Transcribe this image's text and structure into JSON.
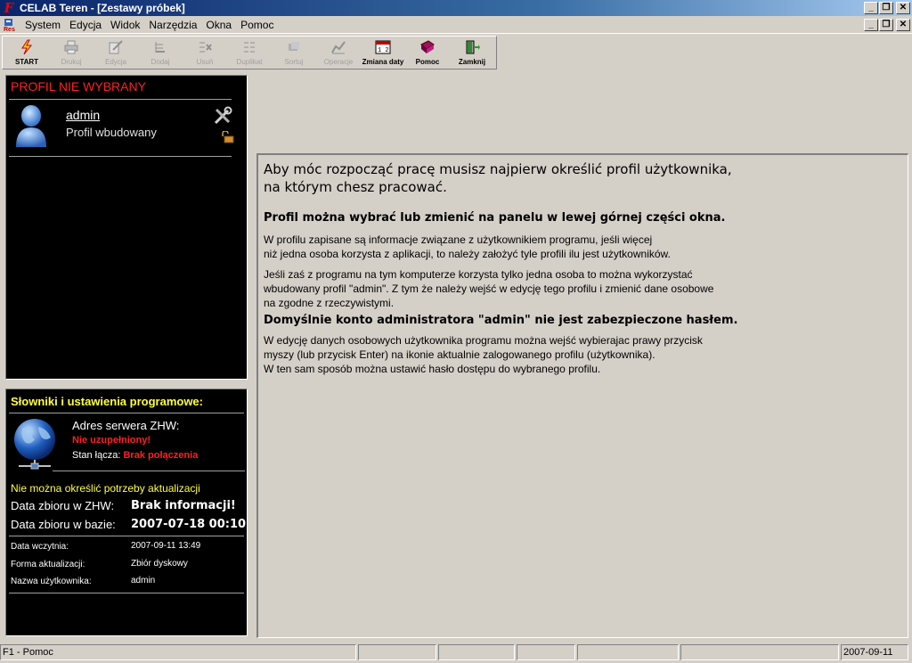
{
  "window": {
    "title": "CELAB Teren - [Zestawy próbek]",
    "app_icon_glyph": "F"
  },
  "menu": {
    "items": [
      "System",
      "Edycja",
      "Widok",
      "Narzędzia",
      "Okna",
      "Pomoc"
    ]
  },
  "toolbar": {
    "buttons": [
      {
        "label": "START",
        "icon": "start-icon",
        "enabled": true
      },
      {
        "label": "Drukuj",
        "icon": "print-icon",
        "enabled": false
      },
      {
        "label": "Edycja",
        "icon": "edit-icon",
        "enabled": false
      },
      {
        "label": "Dodaj",
        "icon": "add-icon",
        "enabled": false
      },
      {
        "label": "Usuń",
        "icon": "delete-icon",
        "enabled": false
      },
      {
        "label": "Duplikat",
        "icon": "duplicate-icon",
        "enabled": false
      },
      {
        "label": "Sortuj",
        "icon": "sort-icon",
        "enabled": false
      },
      {
        "label": "Operacje",
        "icon": "operations-icon",
        "enabled": false
      },
      {
        "label": "Zmiana daty",
        "icon": "calendar-icon",
        "enabled": true
      },
      {
        "label": "Pomoc",
        "icon": "help-book-icon",
        "enabled": true
      },
      {
        "label": "Zamknij",
        "icon": "exit-door-icon",
        "enabled": true
      }
    ]
  },
  "profile_panel": {
    "title": "PROFIL NIE WYBRANY",
    "profile_name": "admin",
    "profile_desc": "Profil wbudowany"
  },
  "settings_panel": {
    "title": "Słowniki i ustawienia programowe:",
    "server_label": "Adres serwera ZHW:",
    "server_value": "Nie uzupełniony!",
    "link_label": "Stan łącza:",
    "link_value": "Brak połączenia",
    "update_note": "Nie można określić potrzeby aktualizacji",
    "zhw_date_label": "Data zbioru w ZHW:",
    "zhw_date_value": "Brak informacji!",
    "db_date_label": "Data zbioru w bazie:",
    "db_date_value": "2007-07-18 00:10",
    "load_date_label": "Data wczytnia:",
    "load_date_value": "2007-09-11 13:49",
    "update_form_label": "Forma aktualizacji:",
    "update_form_value": "Zbiór dyskowy",
    "user_label": "Nazwa użytkownika:",
    "user_value": "admin"
  },
  "info": {
    "headline_1": "Aby móc rozpocząć pracę musisz najpierw określić profil użytkownika,",
    "headline_2": "na którym chesz pracować.",
    "subhead": "Profil można wybrać lub zmienić na panelu w lewej górnej części okna.",
    "p1_1": "W profilu zapisane są informacje związane z użytkownikiem programu, jeśli więcej",
    "p1_2": "niż jedna osoba korzysta z aplikacji, to należy założyć tyle profili ilu jest użytkowników.",
    "p2_1": "Jeśli zaś z programu na tym komputerze korzysta tylko jedna osoba to można wykorzystać",
    "p2_2": "wbudowany profil \"admin\". Z tym że należy wejść w edycję tego profilu i zmienić dane osobowe",
    "p2_3": "na zgodne z rzeczywistymi.",
    "warning": "Domyślnie konto administratora \"admin\" nie jest zabezpieczone hasłem.",
    "p3_1": "W edycję danych osobowych użytkownika programu można wejść wybierajac prawy przycisk",
    "p3_2": "myszy (lub przycisk Enter) na ikonie aktualnie zalogowanego profilu (użytkownika).",
    "p3_3": "W ten sam sposób można ustawić hasło dostępu do wybranego profilu."
  },
  "statusbar": {
    "hint": "F1 - Pomoc",
    "date": "2007-09-11"
  },
  "colors": {
    "title_start": "#0a246a",
    "title_end": "#a6caf0",
    "alert_red": "#ff2020",
    "accent_yellow": "#ffff40",
    "panel_bg": "#000000"
  }
}
